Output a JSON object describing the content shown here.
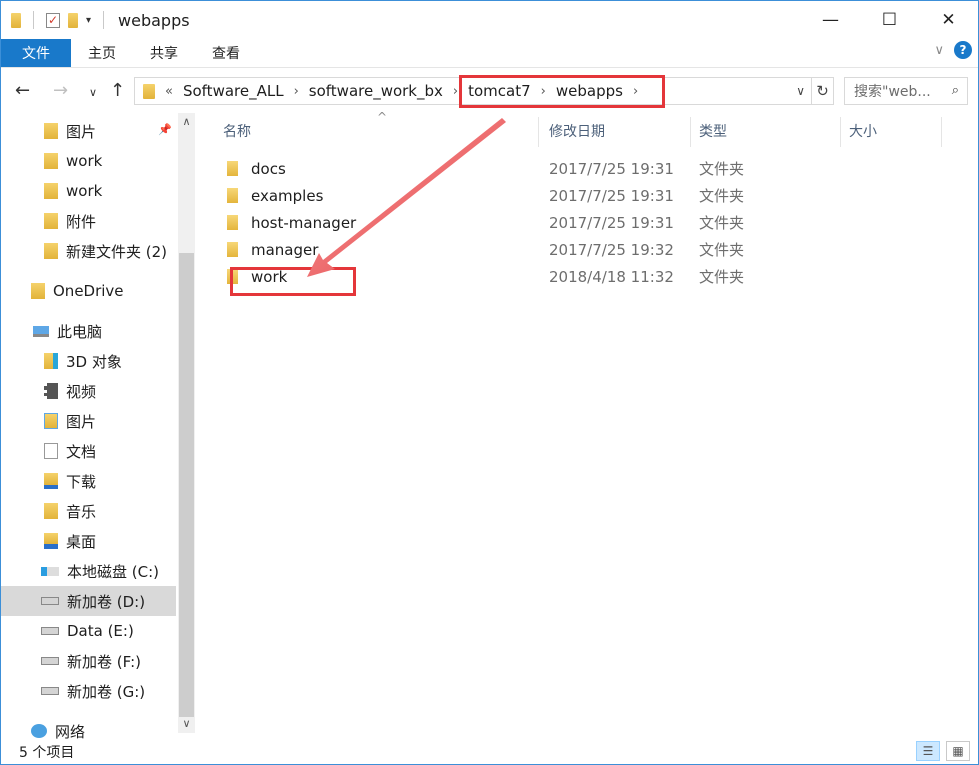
{
  "window": {
    "title": "webapps",
    "minimize": "—",
    "maximize": "☐",
    "close": "✕"
  },
  "ribbon": {
    "tabs": [
      "文件",
      "主页",
      "共享",
      "查看"
    ]
  },
  "address": {
    "prefix": "«",
    "crumbs": [
      "Software_ALL",
      "software_work_bx",
      "tomcat7",
      "webapps"
    ]
  },
  "search": {
    "placeholder": "搜索\"web..."
  },
  "sidebar": {
    "items": [
      {
        "label": "图片",
        "icon": "pictures-folder-icon",
        "pinned": true
      },
      {
        "label": "work",
        "icon": "folder-icon"
      },
      {
        "label": "work",
        "icon": "folder-icon"
      },
      {
        "label": "附件",
        "icon": "folder-icon"
      },
      {
        "label": "新建文件夹 (2)",
        "icon": "folder-icon"
      },
      {
        "label": "OneDrive",
        "icon": "onedrive-icon"
      },
      {
        "label": "此电脑",
        "icon": "pc-icon"
      },
      {
        "label": "3D 对象",
        "icon": "3d-objects-icon"
      },
      {
        "label": "视频",
        "icon": "videos-icon"
      },
      {
        "label": "图片",
        "icon": "pictures-icon"
      },
      {
        "label": "文档",
        "icon": "documents-icon"
      },
      {
        "label": "下载",
        "icon": "downloads-icon"
      },
      {
        "label": "音乐",
        "icon": "music-icon"
      },
      {
        "label": "桌面",
        "icon": "desktop-icon"
      },
      {
        "label": "本地磁盘 (C:)",
        "icon": "windows-drive-icon"
      },
      {
        "label": "新加卷 (D:)",
        "icon": "drive-icon",
        "selected": true
      },
      {
        "label": "Data (E:)",
        "icon": "drive-icon"
      },
      {
        "label": "新加卷 (F:)",
        "icon": "drive-icon"
      },
      {
        "label": "新加卷 (G:)",
        "icon": "drive-icon"
      },
      {
        "label": "网络",
        "icon": "network-icon"
      }
    ]
  },
  "columns": {
    "name": "名称",
    "date": "修改日期",
    "type": "类型",
    "size": "大小"
  },
  "files": [
    {
      "name": "docs",
      "date": "2017/7/25 19:31",
      "type": "文件夹"
    },
    {
      "name": "examples",
      "date": "2017/7/25 19:31",
      "type": "文件夹"
    },
    {
      "name": "host-manager",
      "date": "2017/7/25 19:31",
      "type": "文件夹"
    },
    {
      "name": "manager",
      "date": "2017/7/25 19:32",
      "type": "文件夹"
    },
    {
      "name": "work",
      "date": "2018/4/18 11:32",
      "type": "文件夹"
    }
  ],
  "status": {
    "count": "5 个项目"
  },
  "colors": {
    "accent": "#1979ca",
    "highlight": "#e4363a",
    "folder": "#e8ba44"
  }
}
